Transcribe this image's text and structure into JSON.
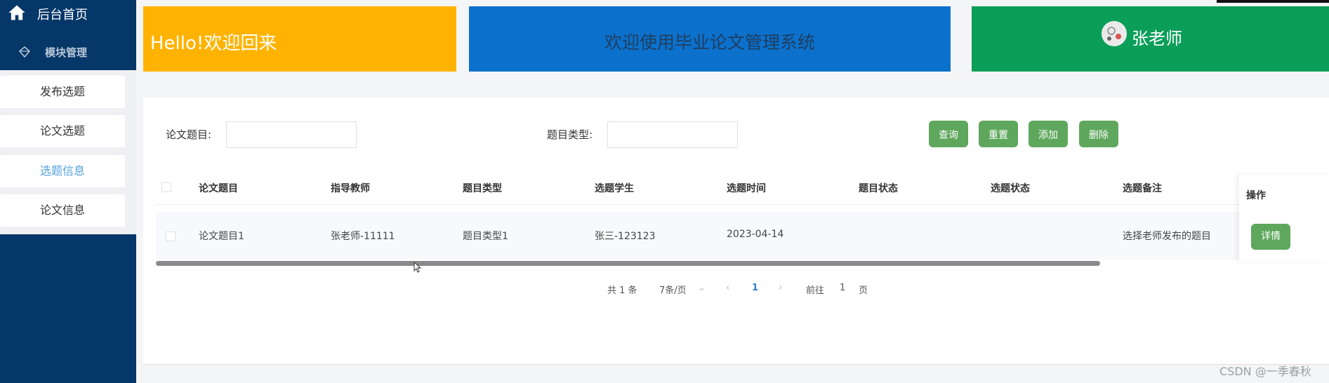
{
  "sidebar": {
    "title": "后台首页",
    "module": "模块管理",
    "items": [
      {
        "label": "发布选题",
        "active": false
      },
      {
        "label": "论文选题",
        "active": false
      },
      {
        "label": "选题信息",
        "active": true
      },
      {
        "label": "论文信息",
        "active": false
      }
    ]
  },
  "banners": {
    "welcome": "Hello!欢迎回来",
    "system": "欢迎使用毕业论文管理系统",
    "user": "张老师"
  },
  "search": {
    "title_label": "论文题目:",
    "title_value": "",
    "type_label": "题目类型:",
    "type_value": ""
  },
  "buttons": {
    "query": "查询",
    "reset": "重置",
    "add": "添加",
    "delete": "删除",
    "detail": "详情"
  },
  "table": {
    "headers": [
      "论文题目",
      "指导教师",
      "题目类型",
      "选题学生",
      "选题时间",
      "题目状态",
      "选题状态",
      "选题备注",
      "操作"
    ],
    "rows": [
      [
        "论文题目1",
        "张老师-11111",
        "题目类型1",
        "张三-123123",
        "2023-04-14",
        "",
        "",
        "选择老师发布的题目"
      ]
    ]
  },
  "pagination": {
    "total": "共 1 条",
    "page_size": "7条/页",
    "current": "1",
    "goto_label": "前往",
    "goto_value": "1",
    "page_suffix": "页"
  },
  "watermark": "CSDN @一季春秋",
  "colors": {
    "sidebar": "#053768",
    "banner_yellow": "#ffb300",
    "banner_blue": "#0c71cc",
    "banner_green": "#0b9e58",
    "button_green": "#5ea75c",
    "active_link": "#54a2dd"
  }
}
